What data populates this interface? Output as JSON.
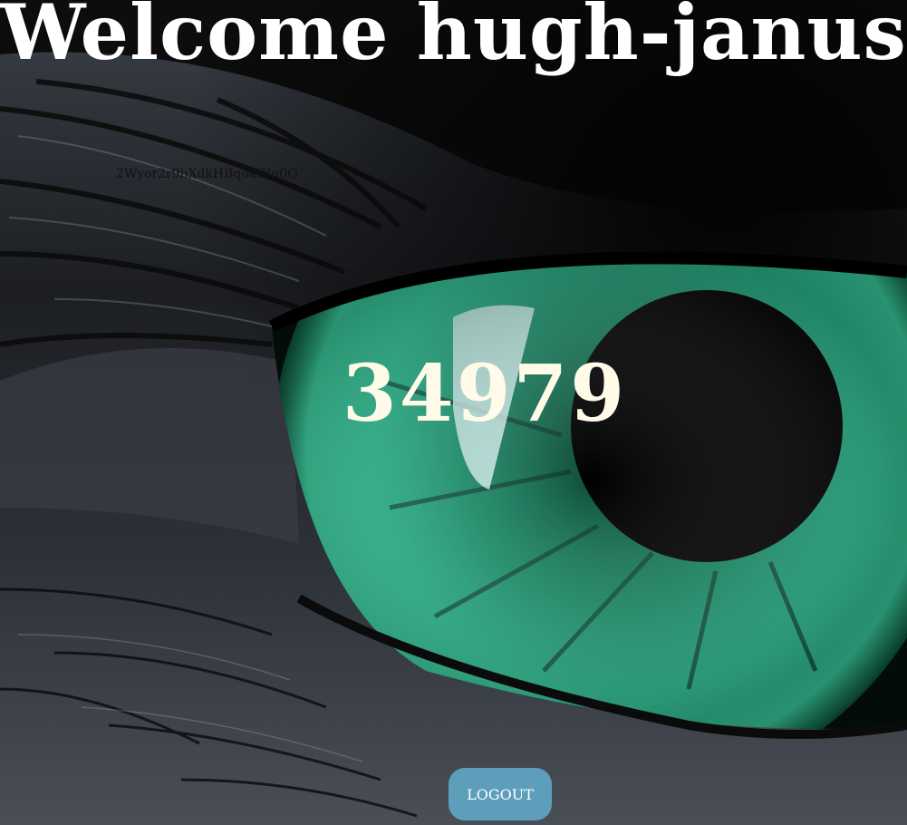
{
  "page": {
    "welcome_prefix": "Welcome",
    "username": "hugh-janus",
    "heading": "Welcome hugh-janus",
    "token": "2Wyor2r9bXdkHBqokRIg0Q",
    "number": "34979",
    "logout_label": "LOGOUT"
  },
  "background": {
    "icon": "green-eye-photo",
    "iris_color": "#2fc89a",
    "skin_color": "#2a2d33"
  },
  "colors": {
    "heading_text": "#ffffff",
    "number_text": "#fffbe8",
    "button_bg": "#5d9fbb",
    "button_text": "#ffffff"
  }
}
